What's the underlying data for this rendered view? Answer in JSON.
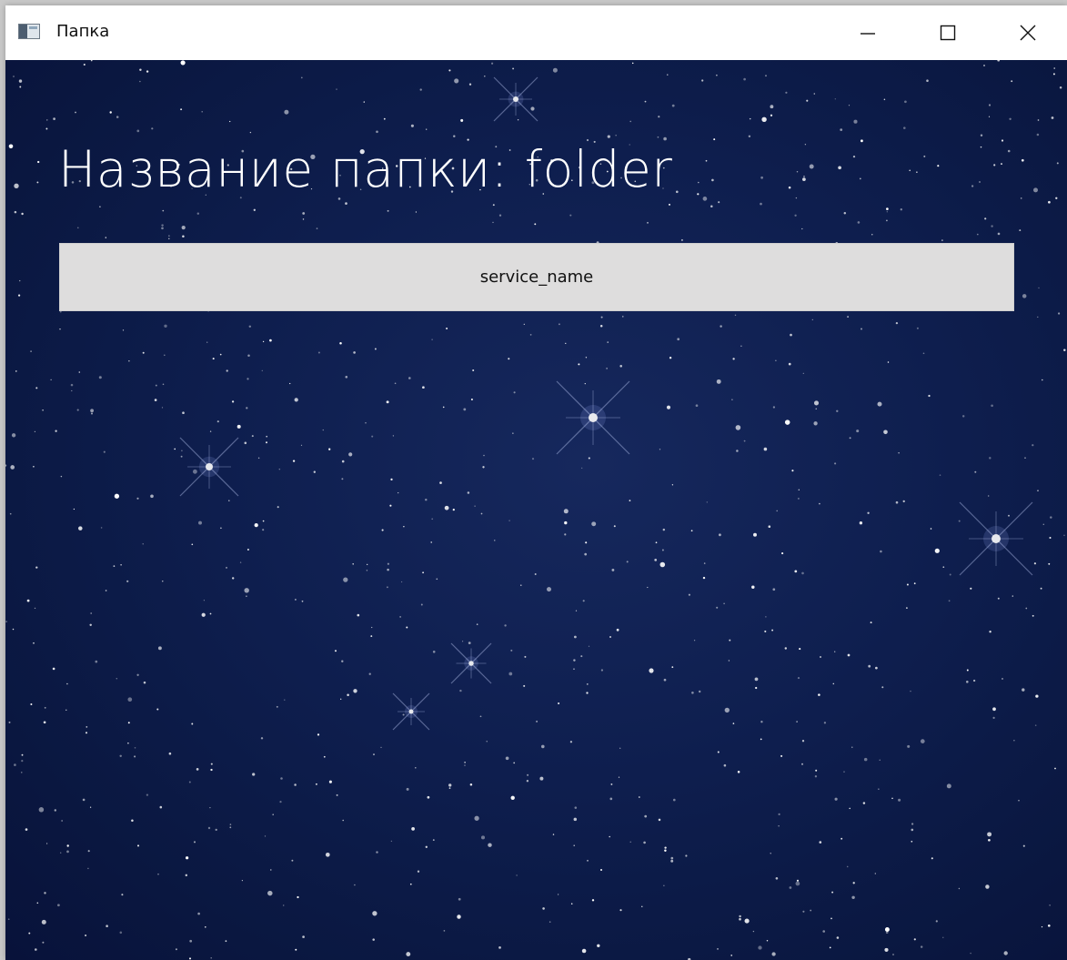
{
  "window": {
    "title": "Папка",
    "icon": "window-app-icon",
    "controls": {
      "minimize_icon": "minimize-icon",
      "maximize_icon": "maximize-icon",
      "close_icon": "close-icon"
    }
  },
  "main": {
    "heading": "Название папки: folder",
    "service_button_label": "service_name",
    "background": "starfield"
  },
  "colors": {
    "sky": "#0e1e4e",
    "button_bg": "#dedddd",
    "heading_text": "#ffffff"
  }
}
